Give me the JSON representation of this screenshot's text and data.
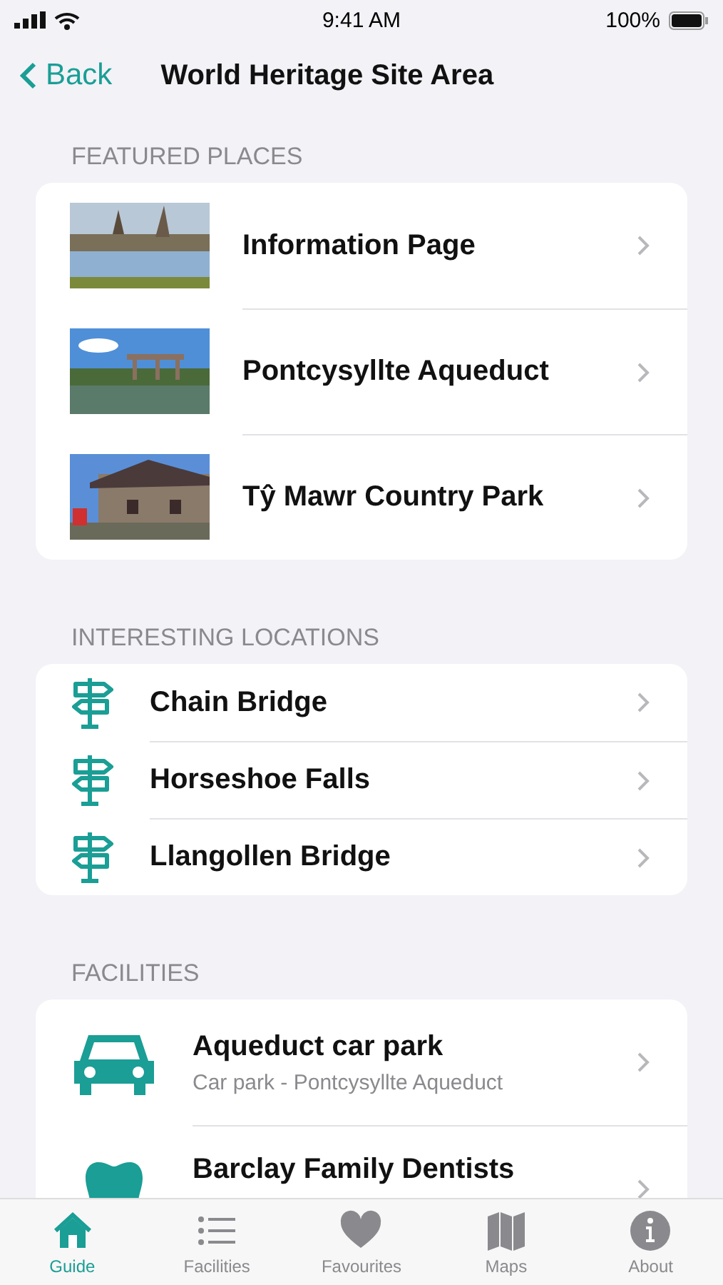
{
  "status_bar": {
    "time": "9:41 AM",
    "battery": "100%"
  },
  "nav": {
    "back": "Back",
    "title": "World Heritage Site Area"
  },
  "sections": [
    {
      "kind": "featured",
      "title": "FEATURED PLACES",
      "items": [
        {
          "label": "Information Page"
        },
        {
          "label": "Pontcysyllte Aqueduct"
        },
        {
          "label": "Tŷ Mawr Country Park"
        }
      ]
    },
    {
      "kind": "locations",
      "title": "INTERESTING LOCATIONS",
      "items": [
        {
          "label": "Chain Bridge"
        },
        {
          "label": "Horseshoe Falls"
        },
        {
          "label": "Llangollen Bridge"
        }
      ]
    },
    {
      "kind": "facilities",
      "title": "FACILITIES",
      "items": [
        {
          "label": "Aqueduct car park",
          "subtitle": "Car park - Pontcysyllte Aqueduct"
        },
        {
          "label": "Barclay Family Dentists"
        }
      ]
    }
  ],
  "tab_bar": [
    {
      "label": "Guide",
      "selected": true
    },
    {
      "label": "Facilities",
      "selected": false
    },
    {
      "label": "Favourites",
      "selected": false
    },
    {
      "label": "Maps",
      "selected": false
    },
    {
      "label": "About",
      "selected": false
    }
  ]
}
